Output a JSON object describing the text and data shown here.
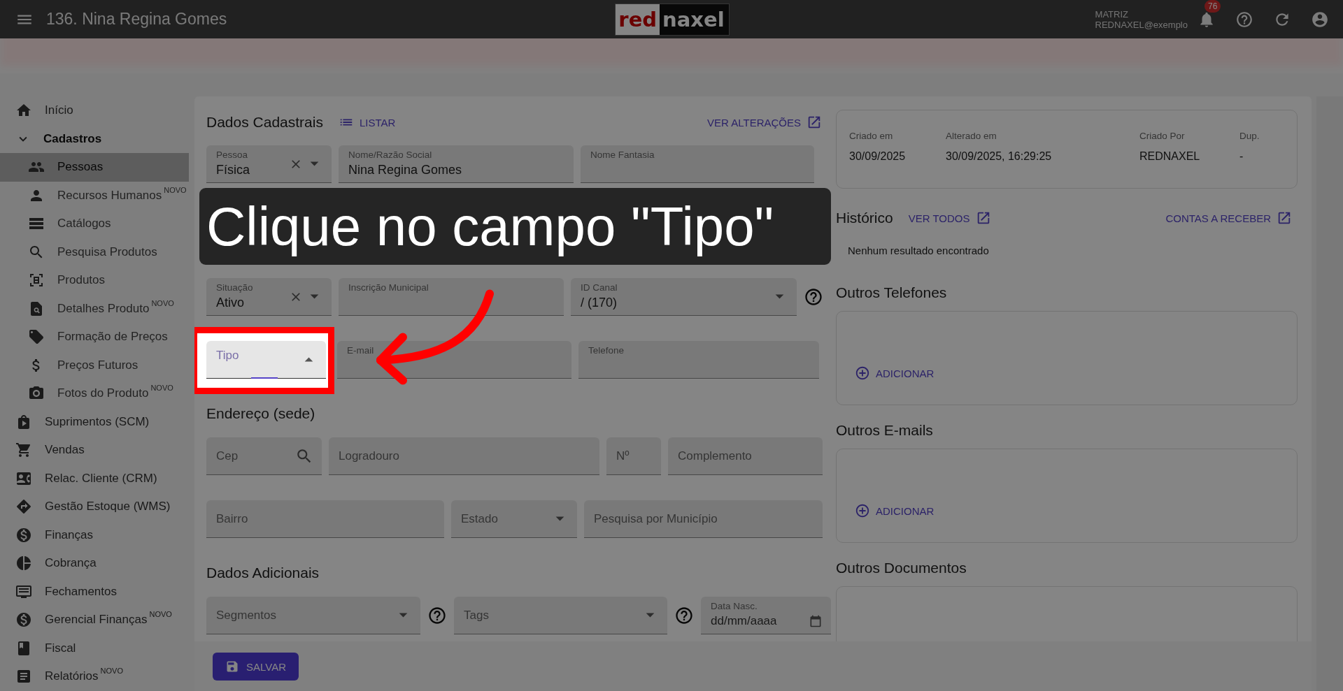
{
  "app_bar": {
    "title": "136. Nina Regina Gomes",
    "logo": [
      "red",
      "naxel"
    ],
    "company": "MATRIZ",
    "user": "REDNAXEL@exemplo",
    "notifications": "76"
  },
  "sidebar": {
    "items": [
      {
        "label": "Início",
        "selected": false
      },
      {
        "label": "Cadastros",
        "selected": false,
        "expanded": true,
        "children": [
          {
            "label": "Pessoas",
            "selected": true
          },
          {
            "label": "Recursos Humanos",
            "badge": "NOVO",
            "selected": false
          },
          {
            "label": "Catálogos",
            "selected": false
          },
          {
            "label": "Pesquisa Produtos",
            "selected": false
          },
          {
            "label": "Produtos",
            "selected": false
          },
          {
            "label": "Detalhes Produto",
            "badge": "NOVO",
            "selected": false
          },
          {
            "label": "Formação de Preços",
            "selected": false
          },
          {
            "label": "Preços Futuros",
            "selected": false
          },
          {
            "label": "Fotos do Produto",
            "badge": "NOVO",
            "selected": false
          }
        ]
      },
      {
        "label": "Suprimentos (SCM)",
        "selected": false
      },
      {
        "label": "Vendas",
        "selected": false
      },
      {
        "label": "Relac. Cliente (CRM)",
        "selected": false
      },
      {
        "label": "Gestão Estoque (WMS)",
        "selected": false
      },
      {
        "label": "Finanças",
        "selected": false
      },
      {
        "label": "Cobrança",
        "selected": false
      },
      {
        "label": "Fechamentos",
        "selected": false
      },
      {
        "label": "Gerencial Finanças",
        "badge": "NOVO",
        "selected": false
      },
      {
        "label": "Fiscal",
        "selected": false
      },
      {
        "label": "Relatórios",
        "badge": "NOVO",
        "selected": false
      }
    ]
  },
  "form": {
    "title": "Dados Cadastrais",
    "list_action": "LISTAR",
    "changes_action": "VER ALTERAÇÕES",
    "sections": [
      {
        "rows": [
          {
            "fields": [
              {
                "label": "Pessoa",
                "value": "Física",
                "kind": "select",
                "clearable": true,
                "help": false,
                "focused": false
              },
              {
                "label": "Nome/Razão Social",
                "value": "Nina Regina Gomes",
                "kind": "text",
                "clearable": false,
                "help": false,
                "focused": false
              },
              {
                "label": "Nome Fantasia",
                "kind": "text",
                "floated": true,
                "clearable": false,
                "help": false,
                "focused": false
              }
            ]
          },
          {
            "fields": [
              {
                "label": "Situação",
                "value": "Ativo",
                "kind": "select",
                "clearable": true,
                "help": false,
                "focused": false
              },
              {
                "label": "Inscrição Municipal",
                "kind": "text",
                "floated": true,
                "clearable": false,
                "help": false,
                "focused": false
              },
              {
                "label": "ID Canal",
                "value": "/ (170)",
                "kind": "select",
                "clearable": false,
                "help": true,
                "focused": false
              }
            ]
          },
          {
            "fields": [
              {
                "label": "Tipo",
                "kind": "select",
                "floated": true,
                "clearable": false,
                "help": false,
                "focused": true
              },
              {
                "label": "E-mail",
                "kind": "text",
                "floated": true,
                "clearable": false,
                "help": false,
                "focused": false
              },
              {
                "label": "Telefone",
                "kind": "text",
                "floated": true,
                "clearable": false,
                "help": false,
                "focused": false
              }
            ]
          }
        ]
      },
      {
        "title": "Endereço (sede)",
        "rows": [
          {
            "fields": [
              {
                "label": "Cep",
                "kind": "search",
                "floated": false,
                "clearable": false,
                "help": false,
                "focused": false
              },
              {
                "label": "Logradouro",
                "kind": "text",
                "floated": false,
                "clearable": false,
                "help": false,
                "focused": false
              },
              {
                "label": "Nº",
                "kind": "text",
                "floated": false,
                "clearable": false,
                "help": false,
                "focused": false
              },
              {
                "label": "Complemento",
                "kind": "text",
                "floated": false,
                "clearable": false,
                "help": false,
                "focused": false
              }
            ]
          },
          {
            "fields": [
              {
                "label": "Bairro",
                "kind": "text",
                "floated": false,
                "clearable": false,
                "help": false,
                "focused": false
              },
              {
                "label": "Estado",
                "kind": "select",
                "floated": false,
                "clearable": false,
                "help": false,
                "focused": false
              },
              {
                "label": "Pesquisa por Município",
                "kind": "text",
                "floated": false,
                "clearable": false,
                "help": false,
                "focused": false
              }
            ]
          }
        ]
      },
      {
        "title": "Dados Adicionais",
        "rows": [
          {
            "fields": [
              {
                "label": "Segmentos",
                "kind": "select",
                "floated": false,
                "clearable": false,
                "help": true,
                "focused": false
              },
              {
                "label": "Tags",
                "kind": "select",
                "floated": false,
                "clearable": false,
                "help": true,
                "focused": false
              },
              {
                "label": "Data Nasc.",
                "placeholder": "dd/mm/aaaa",
                "kind": "date",
                "floated": true,
                "clearable": false,
                "help": false,
                "focused": false
              }
            ]
          }
        ]
      }
    ]
  },
  "record_info": [
    {
      "label": "Criado em",
      "value": "30/09/2025"
    },
    {
      "label": "Alterado em",
      "value": "30/09/2025, 16:29:25"
    },
    {
      "label": "Criado Por",
      "value": "REDNAXEL"
    },
    {
      "label": "Dup.",
      "value": "-"
    }
  ],
  "history": {
    "title": "Histórico",
    "view_all": "VER TODOS",
    "receivables": "CONTAS A RECEBER",
    "empty": "Nenhum resultado encontrado"
  },
  "lists": [
    {
      "title": "Outros Telefones",
      "action": "ADICIONAR"
    },
    {
      "title": "Outros E-mails",
      "action": "ADICIONAR"
    },
    {
      "title": "Outros Documentos"
    }
  ],
  "footer": {
    "save": "SALVAR"
  },
  "tutorial": {
    "text": "Clique no campo \"Tipo\""
  }
}
